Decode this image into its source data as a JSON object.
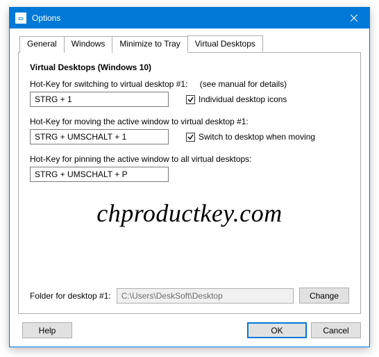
{
  "window": {
    "title": "Options"
  },
  "tabs": {
    "general": "General",
    "windows": "Windows",
    "minimize": "Minimize to Tray",
    "virtual": "Virtual Desktops"
  },
  "panel": {
    "group_title": "Virtual Desktops (Windows 10)",
    "hk_switch_label": "Hot-Key for switching to virtual desktop #1:",
    "hk_switch_hint": "(see manual for details)",
    "hk_switch_value": "STRG + 1",
    "cb_icons_label": "Individual desktop icons",
    "cb_icons_checked": true,
    "hk_move_label": "Hot-Key for moving the active window to virtual desktop #1:",
    "hk_move_value": "STRG + UMSCHALT + 1",
    "cb_switch_label": "Switch to desktop when moving",
    "cb_switch_checked": true,
    "hk_pin_label": "Hot-Key for pinning the active window to all virtual desktops:",
    "hk_pin_value": "STRG + UMSCHALT + P",
    "folder_label": "Folder for desktop #1:",
    "folder_value": "C:\\Users\\DeskSoft\\Desktop",
    "change_btn": "Change"
  },
  "buttons": {
    "help": "Help",
    "ok": "OK",
    "cancel": "Cancel"
  },
  "watermark": "chproductkey.com"
}
